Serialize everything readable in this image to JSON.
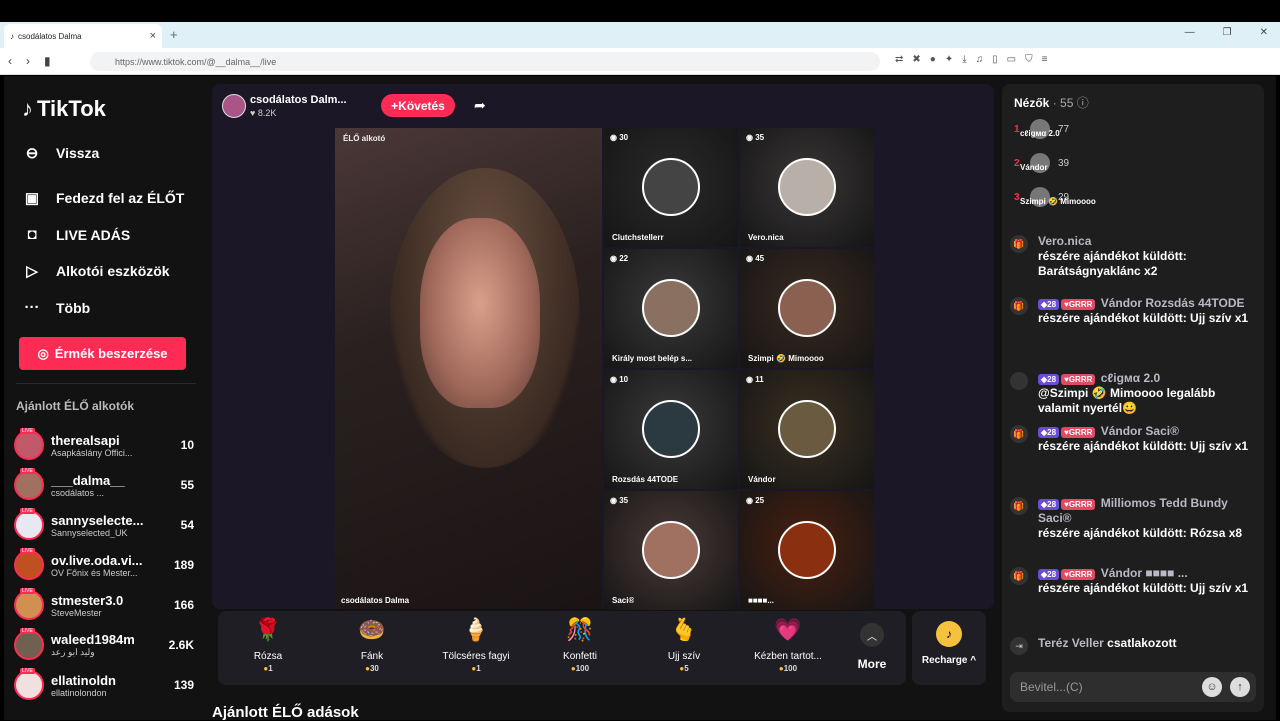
{
  "browser": {
    "tab_title": "csodálatos Dalma",
    "url": "https://www.tiktok.com/@__dalma__/live"
  },
  "sidebar": {
    "logo": "TikTok",
    "nav": [
      {
        "label": "Vissza",
        "icon": "back-arrow-icon"
      },
      {
        "label": "Fedezd fel az ÉLŐT",
        "icon": "tv-icon"
      },
      {
        "label": "LIVE ADÁS",
        "icon": "camera-icon"
      },
      {
        "label": "Alkotói eszközök",
        "icon": "play-icon"
      },
      {
        "label": "Több",
        "icon": "more-dots-icon"
      }
    ],
    "coins_button": "Érmék beszerzése",
    "recommended_title": "Ajánlott ÉLŐ alkotók",
    "creators": [
      {
        "name": "therealsapi",
        "sub": "Asapkáslány Offici...",
        "count": "10",
        "color": "#c05a6a"
      },
      {
        "name": "___dalma__",
        "sub": "csodálatos ...",
        "count": "55",
        "color": "#a07060"
      },
      {
        "name": "sannyselecte...",
        "sub": "Sannyselected_UK",
        "count": "54",
        "color": "#e8e8f0"
      },
      {
        "name": "ov.live.oda.vi...",
        "sub": "OV Főnix és Mester...",
        "count": "189",
        "color": "#c05020"
      },
      {
        "name": "stmester3.0",
        "sub": "SteveMester",
        "count": "166",
        "color": "#d09050"
      },
      {
        "name": "waleed1984m",
        "sub": "وليد ابو رعد",
        "count": "2.6K",
        "color": "#706050"
      },
      {
        "name": "ellatinoldn",
        "sub": "ellatinolondon",
        "count": "139",
        "color": "#f0e0e0"
      }
    ]
  },
  "stage": {
    "host_name": "csodálatos Dalm...",
    "host_likes": "8.2K",
    "follow_label": "Követés",
    "main_label": "ÉLŐ alkotó",
    "main_name": "csodálatos Dalma",
    "guests": [
      {
        "count": "30",
        "name": "Clutchstellerr",
        "bg": "#2a2a2a",
        "av": "#444"
      },
      {
        "count": "35",
        "name": "Vero.nica",
        "bg": "#3a3636",
        "av": "#b8b0a8"
      },
      {
        "count": "22",
        "name": "Király most belép s...",
        "bg": "#3a3a3a",
        "av": "#8a7060"
      },
      {
        "count": "45",
        "name": "Szimpi 🤣 Mimoooo",
        "bg": "#3a2a20",
        "av": "#8a6050"
      },
      {
        "count": "10",
        "name": "Rozsdás 44TODE",
        "bg": "#3a3a3a",
        "av": "#2a3a40"
      },
      {
        "count": "11",
        "name": "Vándor",
        "bg": "#3a3020",
        "av": "#6a5a40"
      },
      {
        "count": "35",
        "name": "Saci®",
        "bg": "#4a3a38",
        "av": "#a07060"
      },
      {
        "count": "25",
        "name": "■■■■...",
        "bg": "#4a2010",
        "av": "#8a3010"
      }
    ],
    "gifts": [
      {
        "name": "Rózsa",
        "price": "1",
        "icon": "🌹"
      },
      {
        "name": "Fánk",
        "price": "30",
        "icon": "🍩"
      },
      {
        "name": "Tölcséres fagyi",
        "price": "1",
        "icon": "🍦"
      },
      {
        "name": "Konfetti",
        "price": "100",
        "icon": "🎊"
      },
      {
        "name": "Ujj szív",
        "price": "5",
        "icon": "🫰"
      },
      {
        "name": "Kézben tartot...",
        "price": "100",
        "icon": "💗"
      }
    ],
    "more_label": "More",
    "recharge_label": "Recharge ^"
  },
  "bottom_title": "Ajánlott ÉLŐ adások",
  "chat": {
    "viewers_title": "Nézők",
    "viewers_count": "· 55",
    "top_viewers": [
      {
        "rank": "1",
        "name": "сℓigмα 2.0",
        "count": "77"
      },
      {
        "rank": "2",
        "name": "Vándor",
        "count": "39"
      },
      {
        "rank": "3",
        "name": "Szimpi 🤣 Mimoooo",
        "count": "29"
      }
    ],
    "messages": [
      {
        "user": "Vero.nica",
        "text": "részére ajándékot küldött: Barátságnyaklánc x2"
      },
      {
        "badges": [
          "28",
          "GRRR"
        ],
        "user": "Vándor  Rozsdás 44TODE",
        "text": "részére ajándékot küldött: Ujj szív x1"
      },
      {
        "badges": [
          "28",
          "GRRR"
        ],
        "user": "сℓigмα 2.0",
        "text": "@Szimpi 🤣 Mimoooo legalább valamit nyertél😀"
      },
      {
        "badges": [
          "28",
          "GRRR"
        ],
        "user": "Vándor  Saci®",
        "text": "részére ajándékot küldött: Ujj szív x1"
      },
      {
        "badges": [
          "28",
          "GRRR"
        ],
        "user": "Milliomos Tedd Bundy  Saci®",
        "text": "részére ajándékot küldött: Rózsa x8"
      },
      {
        "badges": [
          "28",
          "GRRR"
        ],
        "user": "Vándor  ■■■■ ...",
        "text": "részére ajándékot küldött: Ujj szív x1"
      },
      {
        "user": "Teréz Veller",
        "text": "csatlakozott"
      }
    ],
    "input_placeholder": "Bevitel...(C)"
  }
}
